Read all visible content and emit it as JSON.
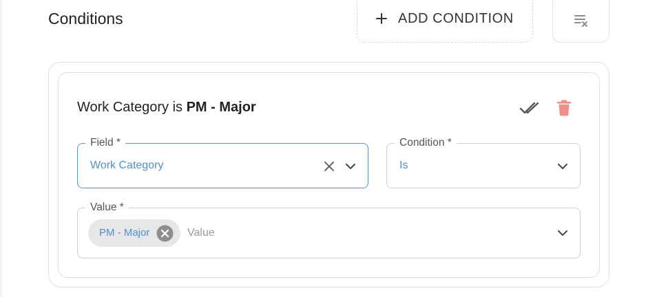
{
  "conditions": {
    "title": "Conditions",
    "add_label": "ADD CONDITION",
    "add_icon": "plus-icon",
    "clear_icon": "clear-all-icon",
    "condition": {
      "summary_prefix": "Work Category is ",
      "summary_value": "PM - Major",
      "check_icon": "double-check-icon",
      "delete_icon": "trash-icon",
      "delete_color": "#ef8f87",
      "field": {
        "label": "Field *",
        "value": "Work Category"
      },
      "operator": {
        "label": "Condition *",
        "value": "Is"
      },
      "value_field": {
        "label": "Value *",
        "chips": [
          {
            "label": "PM - Major"
          }
        ],
        "placeholder": "Value"
      }
    }
  },
  "colors": {
    "accent": "#4f8fd3",
    "focused_border": "#5a95d6",
    "border": "#dedede",
    "delete": "#ef8f87"
  }
}
